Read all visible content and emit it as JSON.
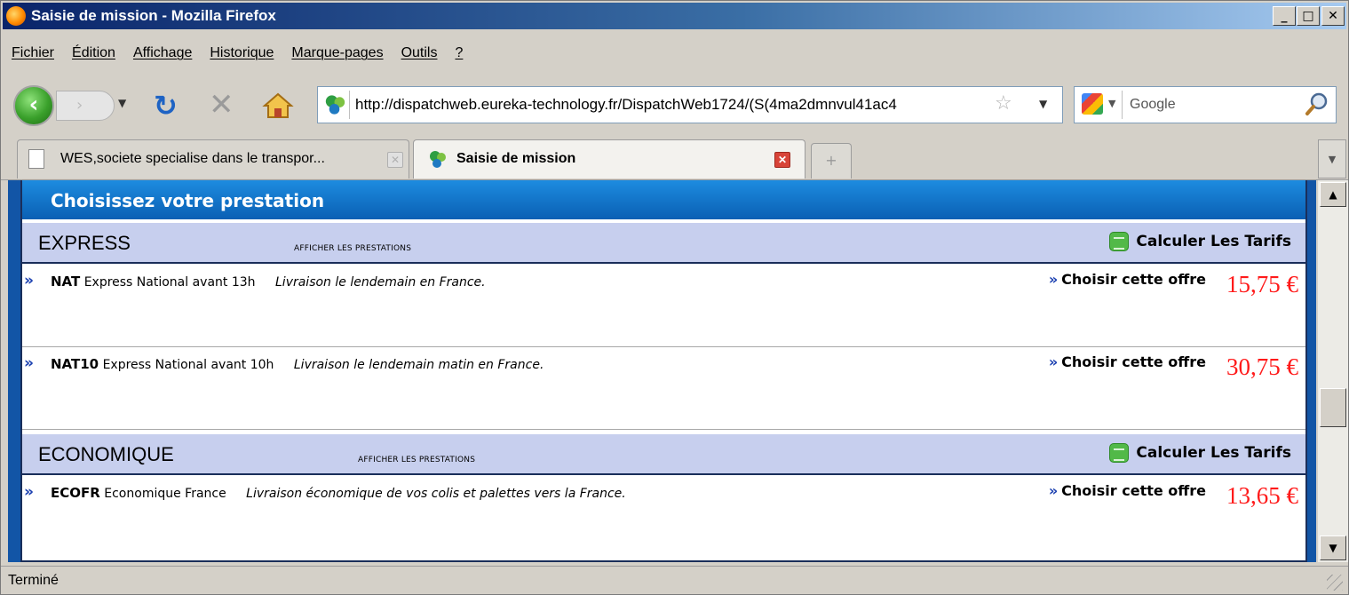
{
  "window": {
    "title": "Saisie de mission - Mozilla Firefox",
    "min_label": "_",
    "max_label": "□",
    "close_label": "✕"
  },
  "menu": [
    "Fichier",
    "Édition",
    "Affichage",
    "Historique",
    "Marque-pages",
    "Outils",
    "?"
  ],
  "nav": {
    "back_label": "‹",
    "forward_label": "›",
    "url": "http://dispatchweb.eureka-technology.fr/DispatchWeb1724/(S(4ma2dmnvul41ac4",
    "search_placeholder": "Google"
  },
  "tabs": [
    {
      "label": "WES,societe specialise dans le transpor...",
      "active": false
    },
    {
      "label": "Saisie de mission",
      "active": true
    }
  ],
  "page": {
    "heading": "Choisissez votre prestation",
    "sections": [
      {
        "name": "EXPRESS",
        "show_label": "AFFICHER LES PRESTATIONS",
        "calc_label": "Calculer Les Tarifs",
        "offers": [
          {
            "code": "NAT",
            "name": "Express National avant 13h",
            "desc": "Livraison le lendemain en France.",
            "choose": "Choisir cette offre",
            "price": "15,75 €"
          },
          {
            "code": "NAT10",
            "name": "Express National avant 10h",
            "desc": "Livraison le lendemain matin en France.",
            "choose": "Choisir cette offre",
            "price": "30,75 €"
          }
        ]
      },
      {
        "name": "ECONOMIQUE",
        "show_label": "AFFICHER LES PRESTATIONS",
        "calc_label": "Calculer Les Tarifs",
        "offers": [
          {
            "code": "ECOFR",
            "name": "Economique France",
            "desc": "Livraison économique de vos colis et palettes vers la France.",
            "choose": "Choisir cette offre",
            "price": "13,65 €"
          }
        ]
      }
    ]
  },
  "status": {
    "text": "Terminé"
  },
  "icons": {
    "app": "firefox-icon",
    "back": "back-arrow-icon",
    "reload": "reload-icon",
    "stop": "stop-icon",
    "home": "home-icon",
    "site": "site-favicon-icon",
    "bookmark": "star-icon",
    "search": "magnifier-icon",
    "calc": "calculator-icon",
    "offer": "double-chevron-icon"
  },
  "colors": {
    "accent": "#1255a6",
    "price": "#ff1a1a",
    "section_bg": "#c7cfee",
    "chevron": "#1a3fb0"
  }
}
